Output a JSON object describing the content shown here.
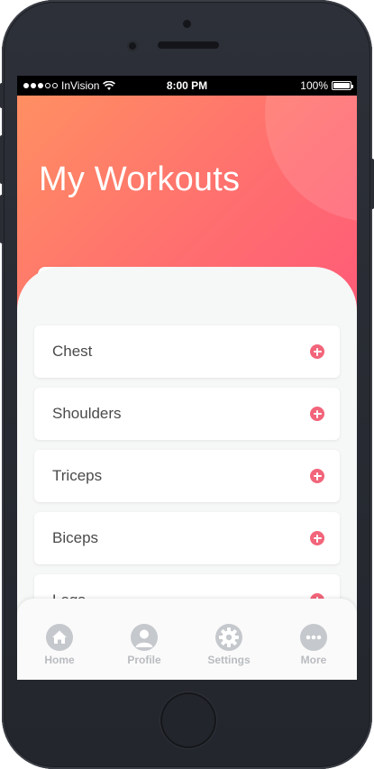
{
  "status_bar": {
    "carrier": "InVision",
    "time": "8:00 PM",
    "battery": "100%"
  },
  "header": {
    "title": "My Workouts"
  },
  "workouts": [
    {
      "label": "Chest"
    },
    {
      "label": "Shoulders"
    },
    {
      "label": "Triceps"
    },
    {
      "label": "Biceps"
    },
    {
      "label": "Legs"
    }
  ],
  "tabbar": {
    "items": [
      {
        "label": "Home",
        "icon": "home-icon"
      },
      {
        "label": "Profile",
        "icon": "profile-icon"
      },
      {
        "label": "Settings",
        "icon": "gear-icon"
      },
      {
        "label": "More",
        "icon": "more-icon"
      }
    ]
  },
  "colors": {
    "accent": "#f4566b",
    "gradient_start": "#ff8f62",
    "gradient_end": "#ff5a78",
    "tab_inactive": "#c5c8cc"
  }
}
